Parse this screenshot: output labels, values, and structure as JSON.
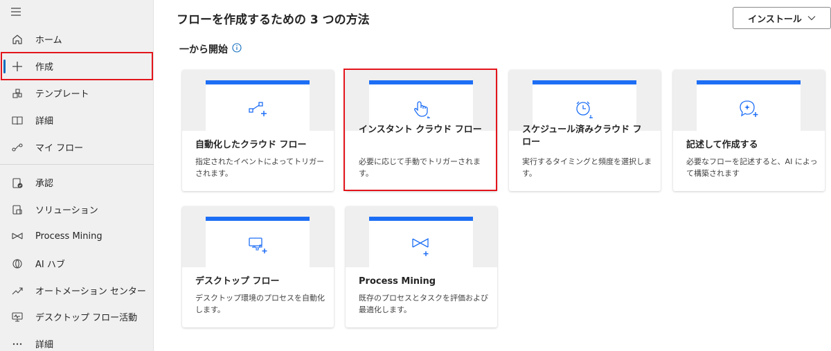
{
  "sidebar": {
    "items": [
      {
        "label": "ホーム",
        "icon": "home-icon"
      },
      {
        "label": "作成",
        "icon": "plus-icon",
        "active": true
      },
      {
        "label": "テンプレート",
        "icon": "templates-icon"
      },
      {
        "label": "詳細",
        "icon": "book-icon"
      },
      {
        "label": "マイ フロー",
        "icon": "flow-icon"
      },
      {
        "label": "承認",
        "icon": "approvals-icon"
      },
      {
        "label": "ソリューション",
        "icon": "solutions-icon"
      },
      {
        "label": "Process Mining",
        "icon": "process-mining-icon"
      },
      {
        "label": "AI ハブ",
        "icon": "ai-hub-icon"
      },
      {
        "label": "オートメーション センター",
        "icon": "automation-center-icon"
      },
      {
        "label": "デスクトップ フロー活動",
        "icon": "desktop-activity-icon"
      },
      {
        "label": "詳細",
        "icon": "more-icon"
      }
    ]
  },
  "main": {
    "title": "フローを作成するための 3 つの方法",
    "install_label": "インストール",
    "section_title": "一から開始",
    "cards": [
      {
        "title": "自動化したクラウド フロー",
        "description": "指定されたイベントによってトリガーされます。",
        "icon": "automated-flow-icon"
      },
      {
        "title": "インスタント クラウド フロー",
        "description": "必要に応じて手動でトリガーされます。",
        "icon": "instant-flow-icon"
      },
      {
        "title": "スケジュール済みクラウド フロー",
        "description": "実行するタイミングと頻度を選択します。",
        "icon": "scheduled-flow-icon"
      },
      {
        "title": "記述して作成する",
        "description": "必要なフローを記述すると、AI によって構築されます",
        "icon": "describe-ai-icon"
      },
      {
        "title": "デスクトップ フロー",
        "description": "デスクトップ環境のプロセスを自動化します。",
        "icon": "desktop-flow-icon"
      },
      {
        "title": "Process Mining",
        "description": "既存のプロセスとタスクを評価および最適化します。",
        "icon": "process-mining-card-icon"
      }
    ]
  },
  "colors": {
    "accent": "#1d6ef5",
    "highlight": "#e3141b",
    "active_indicator": "#0f6cbd"
  }
}
